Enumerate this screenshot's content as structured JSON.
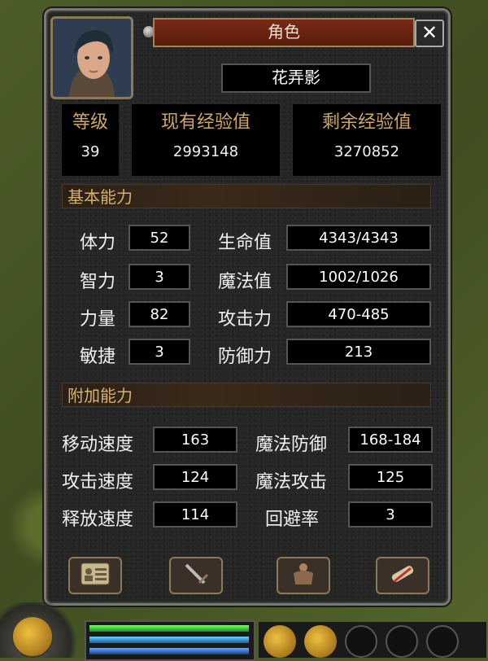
{
  "window": {
    "title": "角色",
    "close_label": "✕"
  },
  "character": {
    "name": "花弄影"
  },
  "header_stats": {
    "level_label": "等级",
    "level": "39",
    "exp_label": "现有经验值",
    "exp": "2993148",
    "remain_label": "剩余经验值",
    "remain": "3270852"
  },
  "basic": {
    "section_title": "基本能力",
    "left": [
      {
        "label": "体力",
        "value": "52"
      },
      {
        "label": "智力",
        "value": "3"
      },
      {
        "label": "力量",
        "value": "82"
      },
      {
        "label": "敏捷",
        "value": "3"
      }
    ],
    "right": [
      {
        "label": "生命值",
        "value": "4343/4343"
      },
      {
        "label": "魔法值",
        "value": "1002/1026"
      },
      {
        "label": "攻击力",
        "value": "470-485"
      },
      {
        "label": "防御力",
        "value": "213"
      }
    ]
  },
  "extra": {
    "section_title": "附加能力",
    "left": [
      {
        "label": "移动速度",
        "value": "163"
      },
      {
        "label": "攻击速度",
        "value": "124"
      },
      {
        "label": "释放速度",
        "value": "114"
      }
    ],
    "right": [
      {
        "label": "魔法防御",
        "value": "168-184"
      },
      {
        "label": "魔法攻击",
        "value": "125"
      },
      {
        "label": "回避率",
        "value": "3"
      }
    ]
  },
  "tabs": [
    {
      "icon": "character-card-icon"
    },
    {
      "icon": "sword-icon"
    },
    {
      "icon": "armor-icon"
    },
    {
      "icon": "scroll-icon"
    }
  ],
  "colors": {
    "accent_gold": "#d0a860",
    "title_red": "#7a2a14"
  }
}
